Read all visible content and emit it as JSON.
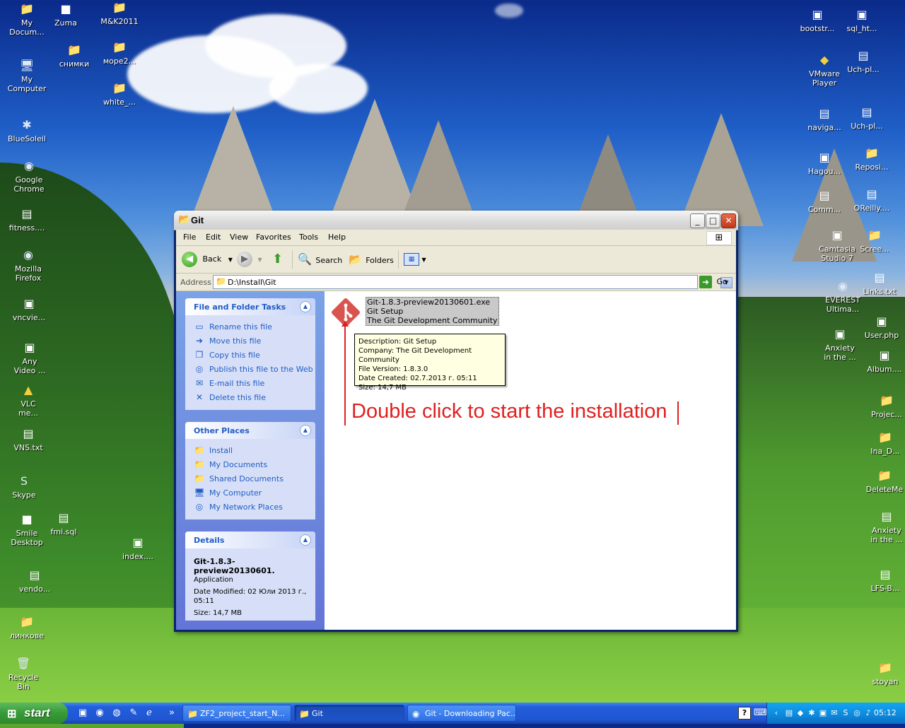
{
  "desktop": {
    "icons": [
      {
        "label": "My\nDocum...",
        "glyph": "📁",
        "kind": "folder"
      },
      {
        "label": "Zuma",
        "glyph": "■",
        "kind": "file"
      },
      {
        "label": "M&K2011",
        "glyph": "📁",
        "kind": "folder"
      },
      {
        "label": "снимки",
        "glyph": "📁",
        "kind": "folder"
      },
      {
        "label": "море2...",
        "glyph": "📁",
        "kind": "folder"
      },
      {
        "label": "My\nComputer",
        "glyph": "🖥",
        "kind": "doc"
      },
      {
        "label": "white_...",
        "glyph": "📁",
        "kind": "folder"
      },
      {
        "label": "BlueSoleil",
        "glyph": "✱",
        "kind": "doc"
      },
      {
        "label": "Google\nChrome",
        "glyph": "◉",
        "kind": "doc"
      },
      {
        "label": "fitness....",
        "glyph": "▤",
        "kind": "file"
      },
      {
        "label": "Mozilla\nFirefox",
        "glyph": "◉",
        "kind": "doc"
      },
      {
        "label": "vncvie...",
        "glyph": "▣",
        "kind": "file"
      },
      {
        "label": "Any\nVideo ...",
        "glyph": "▣",
        "kind": "file"
      },
      {
        "label": "VLC\nme...",
        "glyph": "▲",
        "kind": "folder"
      },
      {
        "label": "VNS.txt",
        "glyph": "▤",
        "kind": "file"
      },
      {
        "label": "Skype",
        "glyph": "S",
        "kind": "doc"
      },
      {
        "label": "Smile\nDesktop",
        "glyph": "■",
        "kind": "file"
      },
      {
        "label": "fmi.sql",
        "glyph": "▤",
        "kind": "file"
      },
      {
        "label": "index....",
        "glyph": "▣",
        "kind": "file"
      },
      {
        "label": "vendo...",
        "glyph": "▤",
        "kind": "file"
      },
      {
        "label": "линкове",
        "glyph": "📁",
        "kind": "folder"
      },
      {
        "label": "Recycle\nBin",
        "glyph": "🗑",
        "kind": "doc"
      },
      {
        "label": "bootstr...",
        "glyph": "▣",
        "kind": "file"
      },
      {
        "label": "sql_ht...",
        "glyph": "▣",
        "kind": "file"
      },
      {
        "label": "VMware\nPlayer",
        "glyph": "◆",
        "kind": "folder"
      },
      {
        "label": "Uch-pl...",
        "glyph": "▤",
        "kind": "file"
      },
      {
        "label": "naviga...",
        "glyph": "▤",
        "kind": "file"
      },
      {
        "label": "Uch-pl...",
        "glyph": "▤",
        "kind": "file"
      },
      {
        "label": "Hagou...",
        "glyph": "▣",
        "kind": "file"
      },
      {
        "label": "Reposi...",
        "glyph": "📁",
        "kind": "folder"
      },
      {
        "label": "Comm...",
        "glyph": "▤",
        "kind": "file"
      },
      {
        "label": "OReilly....",
        "glyph": "▤",
        "kind": "file"
      },
      {
        "label": "Camtasia\nStudio 7",
        "glyph": "▣",
        "kind": "file"
      },
      {
        "label": "Scree...",
        "glyph": "📁",
        "kind": "folder"
      },
      {
        "label": "EVEREST\nUltima...",
        "glyph": "◉",
        "kind": "doc"
      },
      {
        "label": "Links.txt",
        "glyph": "▤",
        "kind": "file"
      },
      {
        "label": "Anxiety\nin the ...",
        "glyph": "▣",
        "kind": "file"
      },
      {
        "label": "User.php",
        "glyph": "▣",
        "kind": "file"
      },
      {
        "label": "Album....",
        "glyph": "▣",
        "kind": "file"
      },
      {
        "label": "Projec...",
        "glyph": "📁",
        "kind": "folder"
      },
      {
        "label": "Ina_D...",
        "glyph": "📁",
        "kind": "folder"
      },
      {
        "label": "DeleteMe",
        "glyph": "📁",
        "kind": "folder"
      },
      {
        "label": "Anxiety\nin the ...",
        "glyph": "▤",
        "kind": "file"
      },
      {
        "label": "LFS-B...",
        "glyph": "▤",
        "kind": "file"
      },
      {
        "label": "stoyan",
        "glyph": "📁",
        "kind": "folder"
      }
    ]
  },
  "window": {
    "title": "Git",
    "menu": [
      "File",
      "Edit",
      "View",
      "Favorites",
      "Tools",
      "Help"
    ],
    "toolbar": {
      "back": "Back",
      "search": "Search",
      "folders": "Folders"
    },
    "address": {
      "label": "Address",
      "value": "D:\\Install\\Git",
      "go": "Go"
    },
    "file_tasks": {
      "title": "File and Folder Tasks",
      "items": [
        {
          "label": "Rename this file",
          "icon": "rename-icon",
          "glyph": "▭"
        },
        {
          "label": "Move this file",
          "icon": "move-icon",
          "glyph": "➜"
        },
        {
          "label": "Copy this file",
          "icon": "copy-icon",
          "glyph": "❐"
        },
        {
          "label": "Publish this file to the Web",
          "icon": "globe-icon",
          "glyph": "◎"
        },
        {
          "label": "E-mail this file",
          "icon": "mail-icon",
          "glyph": "✉"
        },
        {
          "label": "Delete this file",
          "icon": "delete-icon",
          "glyph": "✕"
        }
      ]
    },
    "other_places": {
      "title": "Other Places",
      "items": [
        {
          "label": "Install",
          "icon": "folder-icon",
          "glyph": "📁"
        },
        {
          "label": "My Documents",
          "icon": "folder-icon",
          "glyph": "📁"
        },
        {
          "label": "Shared Documents",
          "icon": "folder-icon",
          "glyph": "📁"
        },
        {
          "label": "My Computer",
          "icon": "computer-icon",
          "glyph": "🖥"
        },
        {
          "label": "My Network Places",
          "icon": "network-icon",
          "glyph": "◎"
        }
      ]
    },
    "details": {
      "title": "Details",
      "name": "Git-1.8.3-preview20130601.",
      "type": "Application",
      "modified": "Date Modified: 02 Юли 2013 г., 05:11",
      "size": "Size: 14,7 MB"
    },
    "file": {
      "name": "Git-1.8.3-preview20130601.exe",
      "description": "Git Setup",
      "company": "The Git Development Community"
    },
    "tooltip": {
      "description": "Description: Git Setup",
      "company": "Company: The Git Development Community",
      "version": "File Version: 1.8.3.0",
      "created": "Date Created: 02.7.2013 г. 05:11",
      "size": "Size: 14,7 MB"
    },
    "annotation": "Double click to start the installation"
  },
  "taskbar": {
    "start": "start",
    "tasks": [
      {
        "label": "ZF2_project_start_N...",
        "active": false
      },
      {
        "label": "Git",
        "active": true
      },
      {
        "label": "Git - Downloading Pac...",
        "active": false
      }
    ],
    "clock": "05:12",
    "chevron": "»"
  }
}
